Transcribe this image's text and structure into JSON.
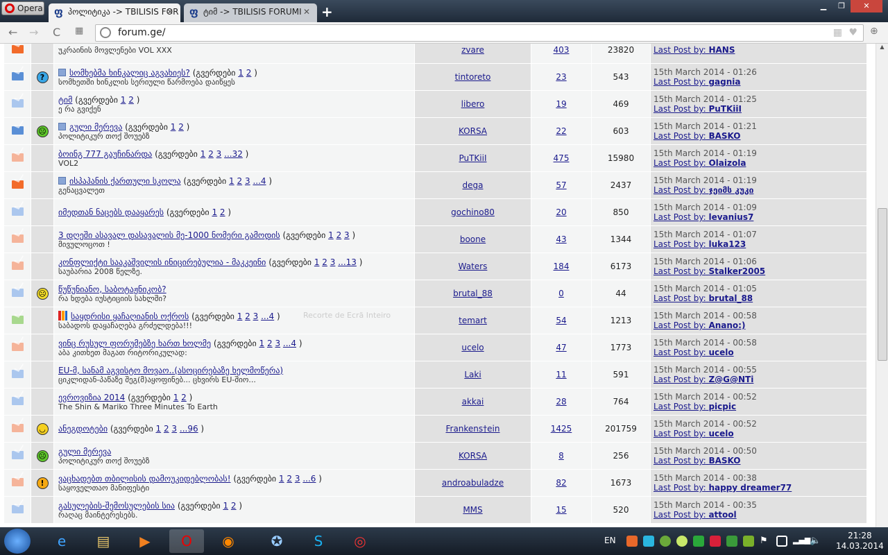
{
  "browser": {
    "opera_label": "Opera",
    "tabs": [
      {
        "title": "პოლიტიკა -> TBILISIS FOR"
      },
      {
        "title": "ტიმ -> TBILISIS FORUMI"
      }
    ],
    "url": "forum.ge/"
  },
  "labels": {
    "pages": "(გვერდები",
    "last_post_by": "Last Post by:"
  },
  "overlay_text": "Recorte de Ecrã Inteiro",
  "colors": {
    "hot": "#f26b2a",
    "warm": "#f5b49a",
    "blue_dark": "#5a8fd6",
    "blue": "#abc7ee",
    "green": "#a8d88e"
  },
  "topics": [
    {
      "env": "hot",
      "title": "",
      "desc": "უკრაინის მოვლენები VOL XXX",
      "author": "zvare",
      "replies": "403",
      "views": "23820",
      "date": "",
      "last_by": "HANS"
    },
    {
      "env": "blue_dark",
      "emoji": "question",
      "mini": true,
      "title": "სომხებმა ხინკალიც აგვახიეს?",
      "pages": [
        "1",
        "2"
      ],
      "desc": "სომხეთში ხინკლის სერიული წარმოება დაიწყეს",
      "author": "tintoreto",
      "replies": "23",
      "views": "543",
      "date": "15th March 2014 - 01:26",
      "last_by": "gagnia"
    },
    {
      "env": "blue",
      "title": "ტიმ",
      "pages": [
        "1",
        "2"
      ],
      "desc": "ე რა გვიქენ",
      "author": "libero",
      "replies": "19",
      "views": "469",
      "date": "15th March 2014 - 01:25",
      "last_by": "PuTKiiI"
    },
    {
      "env": "blue_dark",
      "emoji": "sick",
      "mini": true,
      "title": "გული მერევა",
      "pages": [
        "1",
        "2"
      ],
      "desc": "პოლიტიკურ თოქ შოუებზ",
      "author": "KORSA",
      "replies": "22",
      "views": "603",
      "date": "15th March 2014 - 01:21",
      "last_by": "BASKO"
    },
    {
      "env": "warm",
      "title": "ბოინგ 777 გაუჩინარდა",
      "pages": [
        "1",
        "2",
        "3",
        "...32"
      ],
      "desc": "VOL2",
      "author": "PuTKiiI",
      "replies": "475",
      "views": "15980",
      "date": "15th March 2014 - 01:19",
      "last_by": "Olaizola"
    },
    {
      "env": "hot",
      "mini": true,
      "title": "ისპაჰანის ქართული სკოლა",
      "pages": [
        "1",
        "2",
        "3",
        "...4"
      ],
      "desc": "გენაცვალეთ",
      "author": "dega",
      "replies": "57",
      "views": "2437",
      "date": "15th March 2014 - 01:19",
      "last_by": "ჯეიმს კუკი"
    },
    {
      "env": "blue",
      "title": "იმედთან ნაცებს დააყარეს",
      "pages": [
        "1",
        "2"
      ],
      "desc": "",
      "author": "gochino80",
      "replies": "20",
      "views": "850",
      "date": "15th March 2014 - 01:09",
      "last_by": "levanius7"
    },
    {
      "env": "warm",
      "title": "3 დღეში ასავალ დასავალის მე-1000 ნომერი გამოდის",
      "pages": [
        "1",
        "2",
        "3"
      ],
      "desc": "მივულოცოთ !",
      "author": "boone",
      "replies": "43",
      "views": "1344",
      "date": "15th March 2014 - 01:07",
      "last_by": "luka123"
    },
    {
      "env": "warm",
      "title": "კონფლიქტი სააკაშვილის ინიცირებულია - მაკკეინი",
      "pages": [
        "1",
        "2",
        "3",
        "...13"
      ],
      "desc": "საუბარია 2008 წელზე.",
      "author": "Waters",
      "replies": "184",
      "views": "6173",
      "date": "15th March 2014 - 01:06",
      "last_by": "Stalker2005"
    },
    {
      "env": "blue",
      "emoji": "angry",
      "title": "წუწუნიანო, საბოტაჟნიკობ?",
      "desc": "რა ხდება იუსტიციის სახლში?",
      "author": "brutal_88",
      "replies": "0",
      "views": "44",
      "date": "15th March 2014 - 01:05",
      "last_by": "brutal_88"
    },
    {
      "env": "green",
      "chart": true,
      "title": "საყდრისი ყაჩაღიანის ოქროს",
      "pages": [
        "1",
        "2",
        "3",
        "...4"
      ],
      "desc": "საბადოს დაყაჩაღება გრძელდება!!!",
      "author": "temart",
      "replies": "54",
      "views": "1213",
      "date": "15th March 2014 - 00:58",
      "last_by": "Anano:)"
    },
    {
      "env": "warm",
      "title": "ვინც რუსულ ფორუმებზე ხართ ხოლმე",
      "pages": [
        "1",
        "2",
        "3",
        "...4"
      ],
      "desc": "აბა კითხეთ მაგათ რიტორიკულად:",
      "author": "ucelo",
      "replies": "47",
      "views": "1773",
      "date": "15th March 2014 - 00:58",
      "last_by": "ucelo"
    },
    {
      "env": "blue",
      "title": "EU-მ, სანამ აგვისტო მოვაო..(ასოცირებაზე ხელმოწერა)",
      "desc": "ციკლიდან-პაწაზე შეგ(მ)აყოფინებ... ცხვირს EU-შიო...",
      "author": "Laki",
      "replies": "11",
      "views": "591",
      "date": "15th March 2014 - 00:55",
      "last_by": "Z@G@NTi"
    },
    {
      "env": "blue",
      "title": "ევროვიზია 2014",
      "pages": [
        "1",
        "2"
      ],
      "desc": "The Shin & Mariko Three Minutes To Earth",
      "author": "akkai",
      "replies": "28",
      "views": "764",
      "date": "15th March 2014 - 00:52",
      "last_by": "picpic"
    },
    {
      "env": "warm",
      "emoji": "laugh",
      "title": "ანეგდოტები",
      "pages": [
        "1",
        "2",
        "3",
        "...96"
      ],
      "desc": "",
      "author": "Frankens†ein",
      "replies": "1425",
      "views": "201759",
      "date": "15th March 2014 - 00:52",
      "last_by": "ucelo"
    },
    {
      "env": "blue",
      "emoji": "sick",
      "title": "გული მერევა",
      "desc": "პოლიტიკურ თოქ შოუებზ",
      "author": "KORSA",
      "replies": "8",
      "views": "256",
      "date": "15th March 2014 - 00:50",
      "last_by": "BASKO"
    },
    {
      "env": "warm",
      "emoji": "alert",
      "title": "ვაცხადებთ თბილისის დამოუკიდებლობას!",
      "pages": [
        "1",
        "2",
        "3",
        "...6"
      ],
      "desc": "საყოველთაო მანიფესტი",
      "author": "androabuladze",
      "replies": "82",
      "views": "1673",
      "date": "15th March 2014 - 00:38",
      "last_by": "happy dreamer77"
    },
    {
      "env": "blue",
      "title": "გასულების-შემოსულების სია",
      "pages": [
        "1",
        "2"
      ],
      "desc": "რაღაც მაინტერესებს.",
      "author": "MMS",
      "replies": "15",
      "views": "520",
      "date": "15th March 2014 - 00:35",
      "last_by": "attool"
    }
  ],
  "taskbar": {
    "lang": "EN",
    "time": "21:28",
    "date": "14.03.2014"
  }
}
